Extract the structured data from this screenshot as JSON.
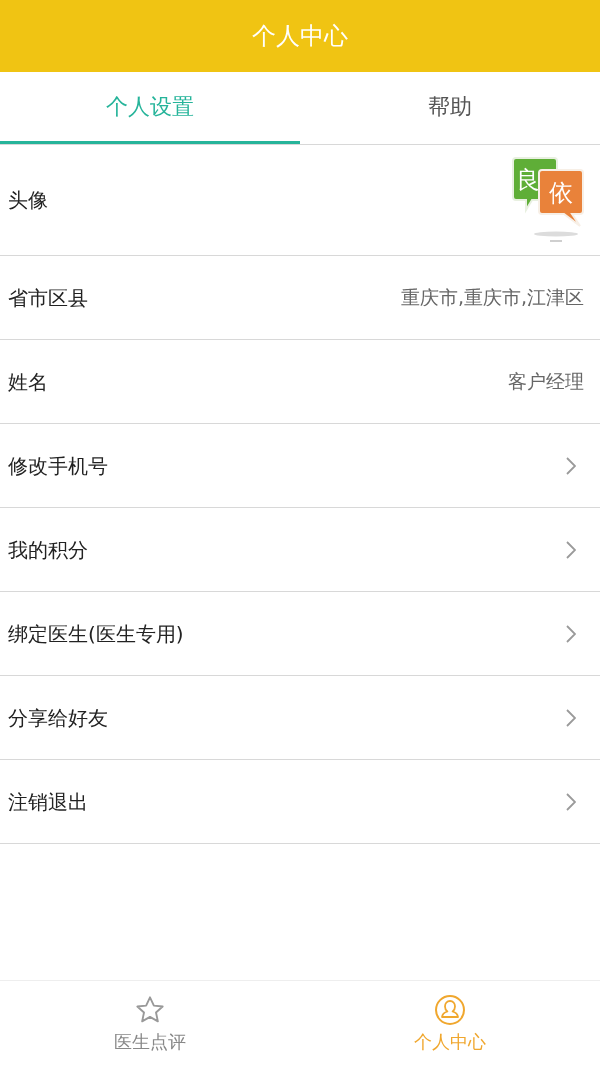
{
  "header": {
    "title": "个人中心"
  },
  "tabs": [
    {
      "label": "个人设置",
      "selected": true
    },
    {
      "label": "帮助",
      "selected": false
    }
  ],
  "avatar_row": {
    "label": "头像",
    "logo_chars": [
      "良",
      "依"
    ]
  },
  "rows": [
    {
      "kind": "value",
      "label": "省市区县",
      "value": "重庆市,重庆市,江津区"
    },
    {
      "kind": "value",
      "label": "姓名",
      "value": "客户经理"
    },
    {
      "kind": "link",
      "label": "修改手机号"
    },
    {
      "kind": "link",
      "label": "我的积分"
    },
    {
      "kind": "link",
      "label": "绑定医生(医生专用)"
    },
    {
      "kind": "link",
      "label": "分享给好友"
    },
    {
      "kind": "link",
      "label": "注销退出"
    }
  ],
  "bottom_nav": [
    {
      "kind": "star",
      "label": "医生点评",
      "selected": false
    },
    {
      "kind": "person",
      "label": "个人中心",
      "selected": true
    }
  ]
}
